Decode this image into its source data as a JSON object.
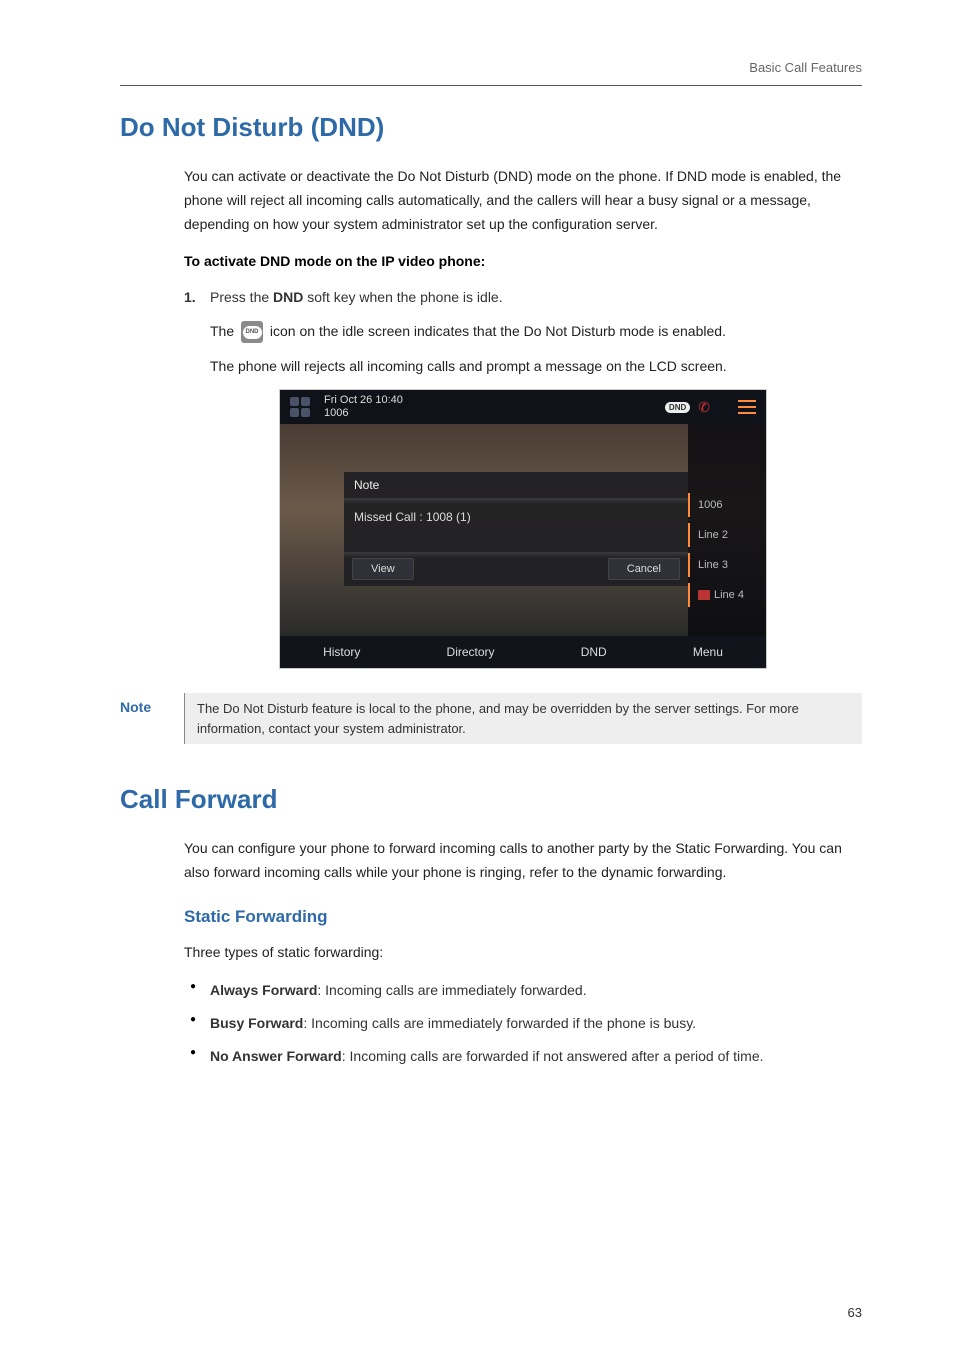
{
  "breadcrumb": "Basic Call Features",
  "section1": {
    "title": "Do Not Disturb (DND)",
    "intro": "You can activate or deactivate the Do Not Disturb (DND) mode on the phone. If DND mode is enabled, the phone will reject all incoming calls automatically, and the callers will hear a busy signal or a message, depending on how your system administrator set up the configuration server.",
    "activate_heading": "To activate DND mode on the IP video phone:",
    "step1_num": "1.",
    "step1_pre": "Press the ",
    "step1_bold": "DND",
    "step1_post": " soft key when the phone is idle.",
    "line2_pre": "The ",
    "line2_chip": "DND",
    "line2_post": " icon on the idle screen indicates that the Do Not Disturb mode is enabled.",
    "line3": "The phone will rejects all incoming calls and prompt a message on the LCD screen."
  },
  "screenshot": {
    "time": "Fri Oct 26 10:40",
    "ext": "1006",
    "dnd_badge": "DND",
    "note_title": "Note",
    "note_msg": "Missed Call : 1008 (1)",
    "btn_view": "View",
    "btn_cancel": "Cancel",
    "lines": [
      "1006",
      "Line 2",
      "Line 3",
      "Line 4"
    ],
    "softkeys": [
      "History",
      "Directory",
      "DND",
      "Menu"
    ]
  },
  "note": {
    "label": "Note",
    "body": "The Do Not Disturb feature is local to the phone, and may be overridden by the server settings. For more information, contact your system administrator."
  },
  "section2": {
    "title": "Call Forward",
    "intro": "You can configure your phone to forward incoming calls to another party by the Static Forwarding. You can also forward incoming calls while your phone is ringing, refer to the dynamic forwarding.",
    "sub_heading": "Static Forwarding",
    "types_intro": "Three types of static forwarding:",
    "bullets": [
      {
        "bold": "Always Forward",
        "rest": ": Incoming calls are immediately forwarded."
      },
      {
        "bold": "Busy Forward",
        "rest": ": Incoming calls are immediately forwarded if the phone is busy."
      },
      {
        "bold": "No Answer Forward",
        "rest": ": Incoming calls are forwarded if not answered after a period of time."
      }
    ]
  },
  "page_number": "63"
}
